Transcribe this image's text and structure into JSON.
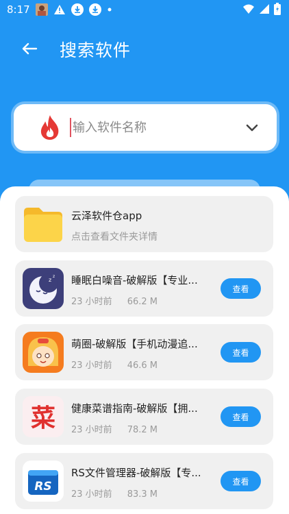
{
  "status_bar": {
    "time": "8:17",
    "icons": [
      "avatar-icon",
      "warning-icon",
      "download-icon",
      "download-icon",
      "dot-icon"
    ],
    "right_icons": [
      "wifi-icon",
      "signal-icon",
      "battery-icon"
    ]
  },
  "header": {
    "title": "搜索软件",
    "back_icon": "back-arrow-icon"
  },
  "search": {
    "placeholder": "输入软件名称",
    "value": "",
    "leading_icon": "flame-icon",
    "trailing_icon": "chevron-down-icon"
  },
  "folder": {
    "name": "云泽软件仓app",
    "subtitle": "点击查看文件夹详情",
    "icon": "folder-icon"
  },
  "apps": [
    {
      "name": "睡眠白噪音-破解版【专业...",
      "time": "23 小时前",
      "size": "66.2 M",
      "icon": "moon-sleep-icon",
      "button": "查看"
    },
    {
      "name": "萌圈-破解版【手机动漫追...",
      "time": "23 小时前",
      "size": "46.6 M",
      "icon": "anime-girl-icon",
      "button": "查看"
    },
    {
      "name": "健康菜谱指南-破解版【拥...",
      "time": "23 小时前",
      "size": "78.2 M",
      "icon": "recipe-icon",
      "button": "查看"
    },
    {
      "name": "RS文件管理器-破解版【专...",
      "time": "23 小时前",
      "size": "83.3 M",
      "icon": "rs-file-manager-icon",
      "button": "查看"
    }
  ],
  "app_icon_texts": {
    "recipe": "菜",
    "rs": "RS"
  },
  "colors": {
    "primary": "#2196F3",
    "card_bg": "#f0f0f0",
    "flame": "#e53935"
  }
}
